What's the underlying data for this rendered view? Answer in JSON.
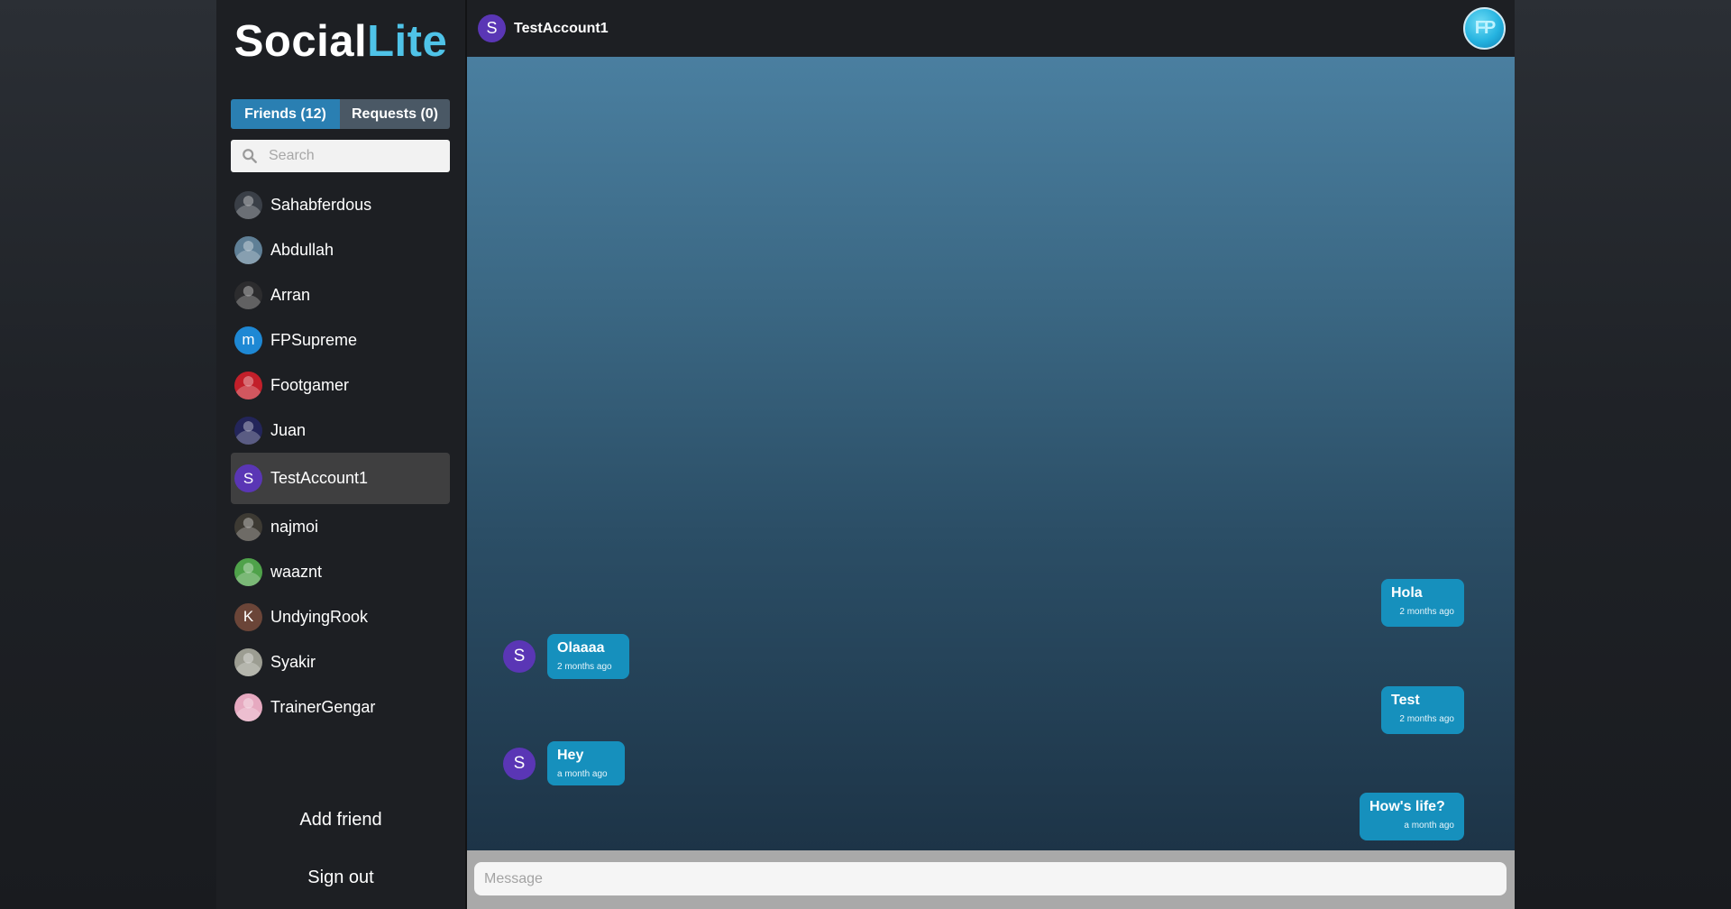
{
  "app": {
    "logo_part1": "Social",
    "logo_part2": "Lite"
  },
  "sidebar": {
    "tabs": [
      {
        "label": "Friends (12)",
        "active": true
      },
      {
        "label": "Requests (0)",
        "active": false
      }
    ],
    "search": {
      "placeholder": "Search"
    },
    "friends": [
      {
        "name": "Sahabferdous",
        "avatar": "photo",
        "color": "#3a3f47"
      },
      {
        "name": "Abdullah",
        "avatar": "photo",
        "color": "#5f7f96"
      },
      {
        "name": "Arran",
        "avatar": "photo",
        "color": "#2c2c2e"
      },
      {
        "name": "FPSupreme",
        "avatar": "m",
        "color": "#1e88d4"
      },
      {
        "name": "Footgamer",
        "avatar": "photo",
        "color": "#c21f2a"
      },
      {
        "name": "Juan",
        "avatar": "photo",
        "color": "#23255a"
      },
      {
        "name": "TestAccount1",
        "avatar": "S",
        "color": "#5a36b5",
        "selected": true
      },
      {
        "name": "najmoi",
        "avatar": "photo",
        "color": "#3d3a33"
      },
      {
        "name": "waaznt",
        "avatar": "photo",
        "color": "#4fa24a"
      },
      {
        "name": "UndyingRook",
        "avatar": "K",
        "color": "#6b4538"
      },
      {
        "name": "Syakir",
        "avatar": "photo",
        "color": "#9c9d92"
      },
      {
        "name": "TrainerGengar",
        "avatar": "photo",
        "color": "#e6a9c0"
      }
    ],
    "add_friend": "Add friend",
    "sign_out": "Sign out"
  },
  "header": {
    "avatar_letter": "S",
    "name": "TestAccount1",
    "my_avatar": "FP"
  },
  "messages": [
    {
      "text": "Hola",
      "time": "2 months ago",
      "side": "right"
    },
    {
      "text": "Olaaaa",
      "time": "2 months ago",
      "side": "left",
      "avatar": "S"
    },
    {
      "text": "Test",
      "time": "2 months ago",
      "side": "right"
    },
    {
      "text": "Hey",
      "time": "a month ago",
      "side": "left",
      "avatar": "S"
    },
    {
      "text": "How's life?",
      "time": "a month ago",
      "side": "right"
    }
  ],
  "composer": {
    "placeholder": "Message"
  },
  "colors": {
    "accent": "#4fc3e8",
    "tab_active": "#2a7fb2",
    "bubble": "#1690bd",
    "sender_avatar": "#5a36b5"
  }
}
